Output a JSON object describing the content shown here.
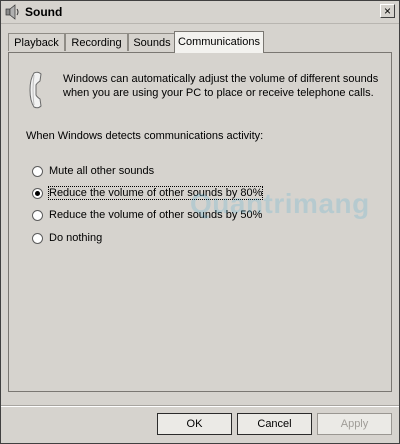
{
  "window": {
    "title": "Sound",
    "close_glyph": "×"
  },
  "tabs": [
    {
      "label": "Playback"
    },
    {
      "label": "Recording"
    },
    {
      "label": "Sounds"
    },
    {
      "label": "Communications",
      "active": true
    }
  ],
  "communications": {
    "icon": "phone-icon",
    "description": "Windows can automatically adjust the volume of different sounds when you are using your PC to place or receive telephone calls.",
    "section_label": "When Windows detects communications activity:",
    "options": [
      {
        "label": "Mute all other sounds",
        "selected": false
      },
      {
        "label": "Reduce the volume of other sounds by 80%",
        "selected": true
      },
      {
        "label": "Reduce the volume of other sounds by 50%",
        "selected": false
      },
      {
        "label": "Do nothing",
        "selected": false
      }
    ]
  },
  "watermark": "Quantrimang",
  "buttons": {
    "ok": "OK",
    "cancel": "Cancel",
    "apply": "Apply"
  },
  "colors": {
    "watermark": "#2aa7d8",
    "panel": "#d6d3ce"
  }
}
